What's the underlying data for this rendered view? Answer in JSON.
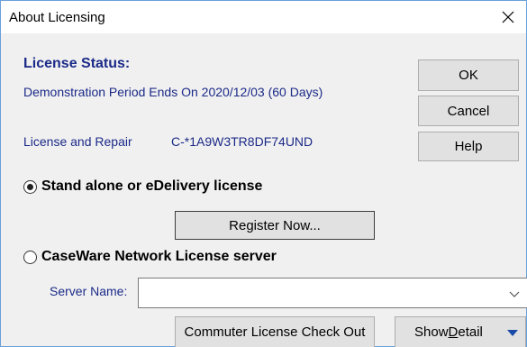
{
  "window": {
    "title": "About Licensing"
  },
  "status": {
    "heading": "License Status:",
    "period_text": "Demonstration Period Ends On 2020/12/03 (60 Days)",
    "license_label": "License and Repair",
    "license_code": "C-*1A9W3TR8DF74UND"
  },
  "buttons": {
    "ok": "OK",
    "cancel": "Cancel",
    "help": "Help",
    "register": "Register Now...",
    "commuter": "Commuter License Check Out",
    "detail_prefix": "Show ",
    "detail_underlined": "D",
    "detail_suffix": "etail"
  },
  "options": {
    "standalone": {
      "label": "Stand alone or eDelivery license",
      "selected": true
    },
    "network": {
      "label": "CaseWare Network License server",
      "selected": false
    }
  },
  "server": {
    "label": "Server Name:",
    "value": ""
  },
  "icons": {
    "close": "close-icon",
    "combo": "chevron-down-icon",
    "detail": "triangle-down-icon"
  },
  "colors": {
    "label_blue": "#1b2a88",
    "accent_arrow": "#1a4aa8"
  }
}
